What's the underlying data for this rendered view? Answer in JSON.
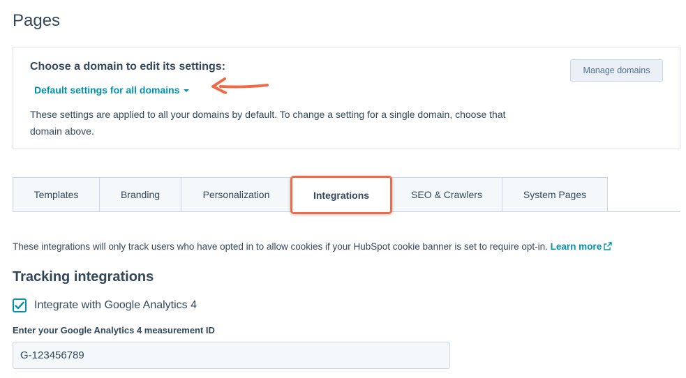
{
  "page": {
    "title": "Pages"
  },
  "domain_panel": {
    "heading": "Choose a domain to edit its settings:",
    "dropdown_value": "Default settings for all domains",
    "description": "These settings are applied to all your domains by default. To change a setting for a single domain, choose that domain above.",
    "manage_button": "Manage domains"
  },
  "tabs": [
    {
      "label": "Templates",
      "active": false
    },
    {
      "label": "Branding",
      "active": false
    },
    {
      "label": "Personalization",
      "active": false
    },
    {
      "label": "Integrations",
      "active": true
    },
    {
      "label": "SEO & Crawlers",
      "active": false
    },
    {
      "label": "System Pages",
      "active": false
    }
  ],
  "integrations": {
    "info_text": "These integrations will only track users who have opted in to allow cookies if your HubSpot cookie banner is set to require opt-in.",
    "learn_more": "Learn more",
    "section_title": "Tracking integrations",
    "ga4_checkbox": {
      "label": "Integrate with Google Analytics 4",
      "checked": true
    },
    "measurement_id": {
      "label": "Enter your Google Analytics 4 measurement ID",
      "value": "G-123456789"
    }
  },
  "colors": {
    "text": "#33475b",
    "link": "#0091ae",
    "annotation": "#ef6b47",
    "border": "#cbd6e2",
    "tab_bg": "#f5f8fa"
  },
  "icons": [
    "caret-down-icon",
    "external-link-icon",
    "checkmark-icon",
    "annotation-arrow"
  ]
}
